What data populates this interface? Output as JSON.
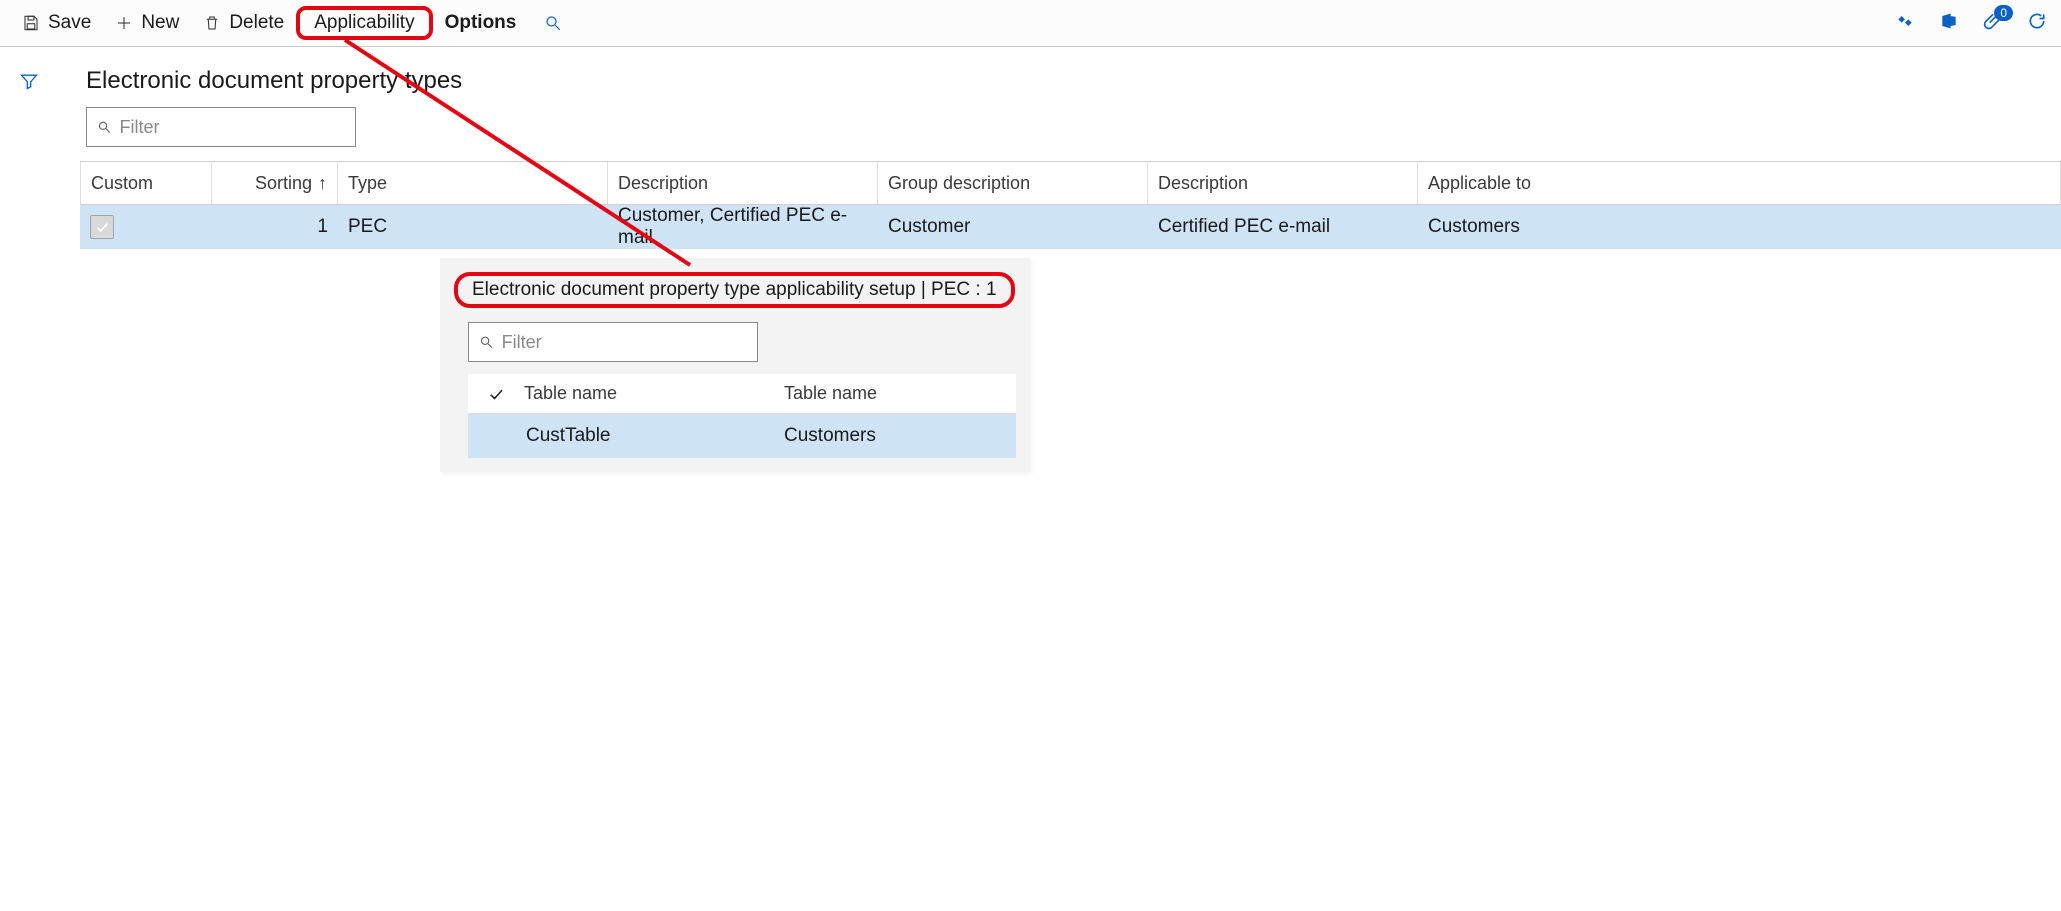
{
  "toolbar": {
    "save": "Save",
    "new": "New",
    "delete": "Delete",
    "applicability": "Applicability",
    "options": "Options",
    "attach_badge": "0"
  },
  "page": {
    "title": "Electronic document property types",
    "filter_placeholder": "Filter"
  },
  "grid": {
    "headers": {
      "custom": "Custom",
      "sorting": "Sorting",
      "type": "Type",
      "description1": "Description",
      "group_description": "Group description",
      "description2": "Description",
      "applicable_to": "Applicable to"
    },
    "rows": [
      {
        "sorting": "1",
        "type": "PEC",
        "description1": "Customer, Certified PEC e-mail",
        "group_description": "Customer",
        "description2": "Certified PEC e-mail",
        "applicable_to": "Customers"
      }
    ]
  },
  "popup": {
    "title": "Electronic document property type applicability setup   |   PEC : 1",
    "filter_placeholder": "Filter",
    "headers": {
      "table_name1": "Table name",
      "table_name2": "Table name"
    },
    "rows": [
      {
        "table_name1": "CustTable",
        "table_name2": "Customers"
      }
    ]
  }
}
